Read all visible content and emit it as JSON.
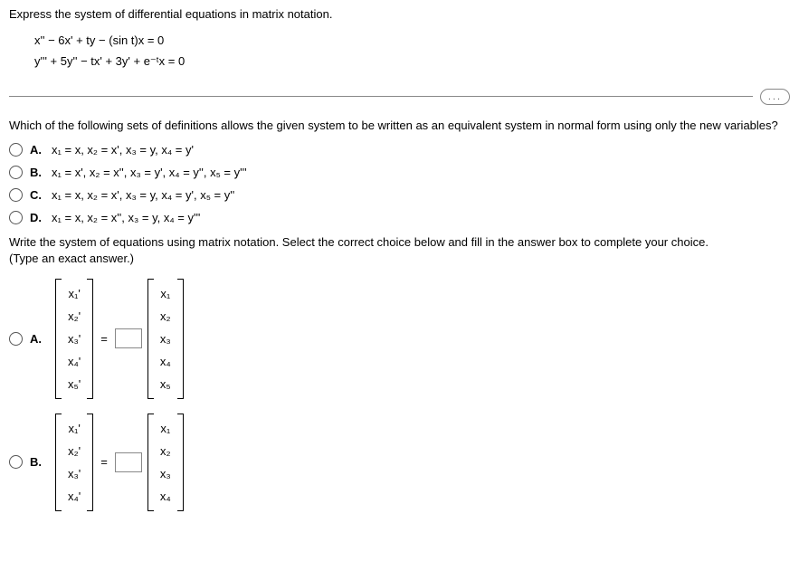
{
  "title": "Express the system of differential equations in matrix notation.",
  "equations": {
    "eq1": "x'' − 6x' + ty − (sin t)x = 0",
    "eq2": "y''' + 5y'' − tx' + 3y' + e⁻ᵗx = 0"
  },
  "ellipsis": "...",
  "question1": "Which of the following sets of definitions allows the given system to be written as an equivalent system in normal form using only the new variables?",
  "q1_choices": {
    "A": {
      "label": "A.",
      "text": "x₁ = x, x₂ = x', x₃ = y, x₄ = y'"
    },
    "B": {
      "label": "B.",
      "text": "x₁ = x', x₂ = x'', x₃ = y', x₄ = y'', x₅ = y'''"
    },
    "C": {
      "label": "C.",
      "text": "x₁ = x, x₂ = x', x₃ = y, x₄ = y', x₅ = y''"
    },
    "D": {
      "label": "D.",
      "text": "x₁ = x, x₂ = x'', x₃ = y, x₄ = y'''"
    }
  },
  "question2": "Write the system of equations using matrix notation. Select the correct choice below and fill in the answer box to complete your choice.",
  "type_note": "(Type an exact answer.)",
  "matrix_labels": {
    "A": "A.",
    "B": "B."
  },
  "matrix_A_left": [
    "x₁'",
    "x₂'",
    "x₃'",
    "x₄'",
    "x₅'"
  ],
  "matrix_A_right": [
    "x₁",
    "x₂",
    "x₃",
    "x₄",
    "x₅"
  ],
  "matrix_B_left": [
    "x₁'",
    "x₂'",
    "x₃'",
    "x₄'"
  ],
  "matrix_B_right": [
    "x₁",
    "x₂",
    "x₃",
    "x₄"
  ],
  "equals": "="
}
